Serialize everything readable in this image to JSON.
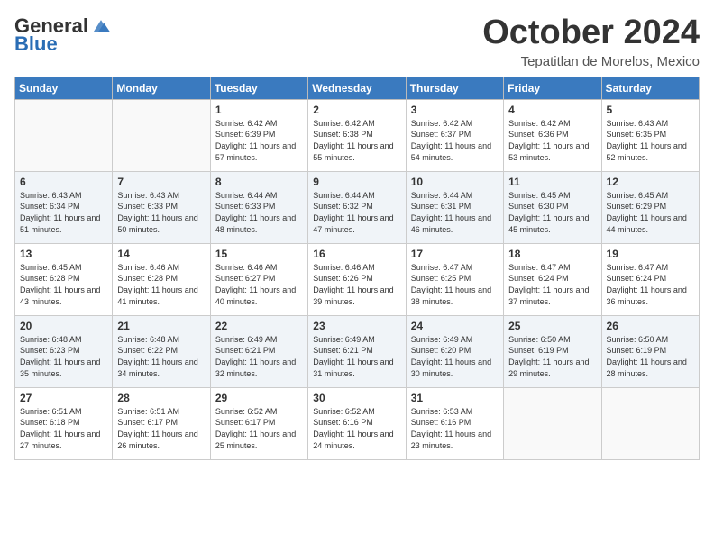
{
  "header": {
    "logo_general": "General",
    "logo_blue": "Blue",
    "month_title": "October 2024",
    "subtitle": "Tepatitlan de Morelos, Mexico"
  },
  "days_of_week": [
    "Sunday",
    "Monday",
    "Tuesday",
    "Wednesday",
    "Thursday",
    "Friday",
    "Saturday"
  ],
  "weeks": [
    {
      "shaded": false,
      "days": [
        {
          "number": "",
          "sunrise": "",
          "sunset": "",
          "daylight": ""
        },
        {
          "number": "",
          "sunrise": "",
          "sunset": "",
          "daylight": ""
        },
        {
          "number": "1",
          "sunrise": "Sunrise: 6:42 AM",
          "sunset": "Sunset: 6:39 PM",
          "daylight": "Daylight: 11 hours and 57 minutes."
        },
        {
          "number": "2",
          "sunrise": "Sunrise: 6:42 AM",
          "sunset": "Sunset: 6:38 PM",
          "daylight": "Daylight: 11 hours and 55 minutes."
        },
        {
          "number": "3",
          "sunrise": "Sunrise: 6:42 AM",
          "sunset": "Sunset: 6:37 PM",
          "daylight": "Daylight: 11 hours and 54 minutes."
        },
        {
          "number": "4",
          "sunrise": "Sunrise: 6:42 AM",
          "sunset": "Sunset: 6:36 PM",
          "daylight": "Daylight: 11 hours and 53 minutes."
        },
        {
          "number": "5",
          "sunrise": "Sunrise: 6:43 AM",
          "sunset": "Sunset: 6:35 PM",
          "daylight": "Daylight: 11 hours and 52 minutes."
        }
      ]
    },
    {
      "shaded": true,
      "days": [
        {
          "number": "6",
          "sunrise": "Sunrise: 6:43 AM",
          "sunset": "Sunset: 6:34 PM",
          "daylight": "Daylight: 11 hours and 51 minutes."
        },
        {
          "number": "7",
          "sunrise": "Sunrise: 6:43 AM",
          "sunset": "Sunset: 6:33 PM",
          "daylight": "Daylight: 11 hours and 50 minutes."
        },
        {
          "number": "8",
          "sunrise": "Sunrise: 6:44 AM",
          "sunset": "Sunset: 6:33 PM",
          "daylight": "Daylight: 11 hours and 48 minutes."
        },
        {
          "number": "9",
          "sunrise": "Sunrise: 6:44 AM",
          "sunset": "Sunset: 6:32 PM",
          "daylight": "Daylight: 11 hours and 47 minutes."
        },
        {
          "number": "10",
          "sunrise": "Sunrise: 6:44 AM",
          "sunset": "Sunset: 6:31 PM",
          "daylight": "Daylight: 11 hours and 46 minutes."
        },
        {
          "number": "11",
          "sunrise": "Sunrise: 6:45 AM",
          "sunset": "Sunset: 6:30 PM",
          "daylight": "Daylight: 11 hours and 45 minutes."
        },
        {
          "number": "12",
          "sunrise": "Sunrise: 6:45 AM",
          "sunset": "Sunset: 6:29 PM",
          "daylight": "Daylight: 11 hours and 44 minutes."
        }
      ]
    },
    {
      "shaded": false,
      "days": [
        {
          "number": "13",
          "sunrise": "Sunrise: 6:45 AM",
          "sunset": "Sunset: 6:28 PM",
          "daylight": "Daylight: 11 hours and 43 minutes."
        },
        {
          "number": "14",
          "sunrise": "Sunrise: 6:46 AM",
          "sunset": "Sunset: 6:28 PM",
          "daylight": "Daylight: 11 hours and 41 minutes."
        },
        {
          "number": "15",
          "sunrise": "Sunrise: 6:46 AM",
          "sunset": "Sunset: 6:27 PM",
          "daylight": "Daylight: 11 hours and 40 minutes."
        },
        {
          "number": "16",
          "sunrise": "Sunrise: 6:46 AM",
          "sunset": "Sunset: 6:26 PM",
          "daylight": "Daylight: 11 hours and 39 minutes."
        },
        {
          "number": "17",
          "sunrise": "Sunrise: 6:47 AM",
          "sunset": "Sunset: 6:25 PM",
          "daylight": "Daylight: 11 hours and 38 minutes."
        },
        {
          "number": "18",
          "sunrise": "Sunrise: 6:47 AM",
          "sunset": "Sunset: 6:24 PM",
          "daylight": "Daylight: 11 hours and 37 minutes."
        },
        {
          "number": "19",
          "sunrise": "Sunrise: 6:47 AM",
          "sunset": "Sunset: 6:24 PM",
          "daylight": "Daylight: 11 hours and 36 minutes."
        }
      ]
    },
    {
      "shaded": true,
      "days": [
        {
          "number": "20",
          "sunrise": "Sunrise: 6:48 AM",
          "sunset": "Sunset: 6:23 PM",
          "daylight": "Daylight: 11 hours and 35 minutes."
        },
        {
          "number": "21",
          "sunrise": "Sunrise: 6:48 AM",
          "sunset": "Sunset: 6:22 PM",
          "daylight": "Daylight: 11 hours and 34 minutes."
        },
        {
          "number": "22",
          "sunrise": "Sunrise: 6:49 AM",
          "sunset": "Sunset: 6:21 PM",
          "daylight": "Daylight: 11 hours and 32 minutes."
        },
        {
          "number": "23",
          "sunrise": "Sunrise: 6:49 AM",
          "sunset": "Sunset: 6:21 PM",
          "daylight": "Daylight: 11 hours and 31 minutes."
        },
        {
          "number": "24",
          "sunrise": "Sunrise: 6:49 AM",
          "sunset": "Sunset: 6:20 PM",
          "daylight": "Daylight: 11 hours and 30 minutes."
        },
        {
          "number": "25",
          "sunrise": "Sunrise: 6:50 AM",
          "sunset": "Sunset: 6:19 PM",
          "daylight": "Daylight: 11 hours and 29 minutes."
        },
        {
          "number": "26",
          "sunrise": "Sunrise: 6:50 AM",
          "sunset": "Sunset: 6:19 PM",
          "daylight": "Daylight: 11 hours and 28 minutes."
        }
      ]
    },
    {
      "shaded": false,
      "days": [
        {
          "number": "27",
          "sunrise": "Sunrise: 6:51 AM",
          "sunset": "Sunset: 6:18 PM",
          "daylight": "Daylight: 11 hours and 27 minutes."
        },
        {
          "number": "28",
          "sunrise": "Sunrise: 6:51 AM",
          "sunset": "Sunset: 6:17 PM",
          "daylight": "Daylight: 11 hours and 26 minutes."
        },
        {
          "number": "29",
          "sunrise": "Sunrise: 6:52 AM",
          "sunset": "Sunset: 6:17 PM",
          "daylight": "Daylight: 11 hours and 25 minutes."
        },
        {
          "number": "30",
          "sunrise": "Sunrise: 6:52 AM",
          "sunset": "Sunset: 6:16 PM",
          "daylight": "Daylight: 11 hours and 24 minutes."
        },
        {
          "number": "31",
          "sunrise": "Sunrise: 6:53 AM",
          "sunset": "Sunset: 6:16 PM",
          "daylight": "Daylight: 11 hours and 23 minutes."
        },
        {
          "number": "",
          "sunrise": "",
          "sunset": "",
          "daylight": ""
        },
        {
          "number": "",
          "sunrise": "",
          "sunset": "",
          "daylight": ""
        }
      ]
    }
  ]
}
